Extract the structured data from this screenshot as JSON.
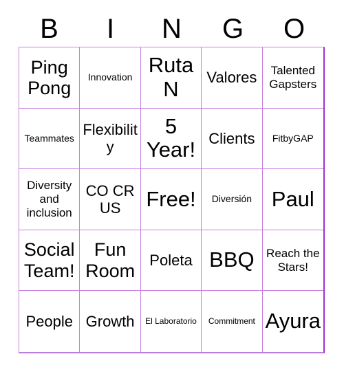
{
  "card": {
    "title": "BINGO",
    "header_letters": [
      "B",
      "I",
      "N",
      "G",
      "O"
    ],
    "colors": {
      "grid_border_inner": "#c77ee0",
      "grid_border_outer": "#9b30d0",
      "text": "#000000",
      "background": "#ffffff"
    },
    "grid": {
      "rows": 5,
      "columns": 5,
      "cells": [
        {
          "text": "Ping Pong",
          "size": "xl"
        },
        {
          "text": "Innovation",
          "size": "sm"
        },
        {
          "text": "Ruta N",
          "size": "xxl"
        },
        {
          "text": "Valores",
          "size": "lg"
        },
        {
          "text": "Talented Gapsters",
          "size": "md"
        },
        {
          "text": "Teammates",
          "size": "sm"
        },
        {
          "text": "Flexibility",
          "size": "lg"
        },
        {
          "text": "5 Year!",
          "size": "xxl"
        },
        {
          "text": "Clients",
          "size": "lg"
        },
        {
          "text": "FitbyGAP",
          "size": "sm"
        },
        {
          "text": "Diversity and inclusion",
          "size": "md"
        },
        {
          "text": "CO CR US",
          "size": "lg"
        },
        {
          "text": "Free!",
          "size": "xxl"
        },
        {
          "text": "Diversión",
          "size": "sm"
        },
        {
          "text": "Paul",
          "size": "xxl"
        },
        {
          "text": "Social Team!",
          "size": "xl"
        },
        {
          "text": "Fun Room",
          "size": "xl"
        },
        {
          "text": "Poleta",
          "size": "lg"
        },
        {
          "text": "BBQ",
          "size": "xxl"
        },
        {
          "text": "Reach the Stars!",
          "size": "md"
        },
        {
          "text": "People",
          "size": "lg"
        },
        {
          "text": "Growth",
          "size": "lg"
        },
        {
          "text": "El Laboratorio",
          "size": "xs"
        },
        {
          "text": "Commitment",
          "size": "xs"
        },
        {
          "text": "Ayura",
          "size": "xxl"
        }
      ]
    }
  }
}
